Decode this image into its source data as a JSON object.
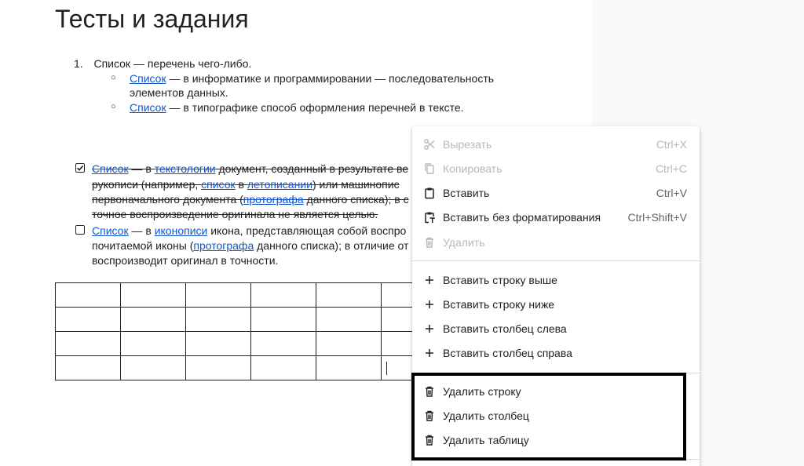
{
  "document": {
    "title": "Тесты и задания",
    "numbered_item": {
      "number": "1.",
      "text": "Список — перечень чего-либо."
    },
    "sub_items": [
      {
        "link": "Список",
        "text": " — в информатике и программировании — последовательность",
        "line2": "элементов данных."
      },
      {
        "link": "Список",
        "text": " — в типографике способ оформления перечней в тексте."
      }
    ],
    "checked_item": {
      "checked": true,
      "line1": {
        "link1": "Список",
        "t1": " — в ",
        "link2": "текстологии",
        "t2": " документ, созданный в результате ве"
      },
      "line2": {
        "t1": "рукописи (например, ",
        "link1": "список",
        "t2": " в ",
        "link2": "летописании",
        "t3": ") или машинопис"
      },
      "line3": {
        "t1": "первоначального документа (",
        "link1": "протографа",
        "t2": " данного списка); в с"
      },
      "line4": {
        "t1": "точное воспроизведение оригинала не является целью."
      }
    },
    "unchecked_item": {
      "checked": false,
      "line1": {
        "link1": "Список",
        "t1": " — в ",
        "link2": "иконописи",
        "t2": " икона, представляющая собой воспро"
      },
      "line2": {
        "t1": "почитаемой иконы (",
        "link1": "протографа",
        "t2": " данного списка); в отличие от"
      },
      "line3": {
        "t1": "воспроизводит оригинал в точности."
      }
    },
    "table": {
      "rows": 4,
      "cols": 6
    }
  },
  "context_menu": {
    "group1": [
      {
        "icon": "scissors-icon",
        "label": "Вырезать",
        "shortcut": "Ctrl+X",
        "disabled": true
      },
      {
        "icon": "copy-icon",
        "label": "Копировать",
        "shortcut": "Ctrl+C",
        "disabled": true
      },
      {
        "icon": "clipboard-icon",
        "label": "Вставить",
        "shortcut": "Ctrl+V",
        "disabled": false
      },
      {
        "icon": "clipboard-plain-icon",
        "label": "Вставить без форматирования",
        "shortcut": "Ctrl+Shift+V",
        "disabled": false
      },
      {
        "icon": "trash-icon",
        "label": "Удалить",
        "shortcut": "",
        "disabled": true
      }
    ],
    "group2": [
      {
        "icon": "plus-icon",
        "label": "Вставить строку выше"
      },
      {
        "icon": "plus-icon",
        "label": "Вставить строку ниже"
      },
      {
        "icon": "plus-icon",
        "label": "Вставить столбец слева"
      },
      {
        "icon": "plus-icon",
        "label": "Вставить столбец справа"
      }
    ],
    "group3": [
      {
        "icon": "trash-icon",
        "label": "Удалить строку"
      },
      {
        "icon": "trash-icon",
        "label": "Удалить столбец"
      },
      {
        "icon": "trash-icon",
        "label": "Удалить таблицу"
      }
    ]
  }
}
